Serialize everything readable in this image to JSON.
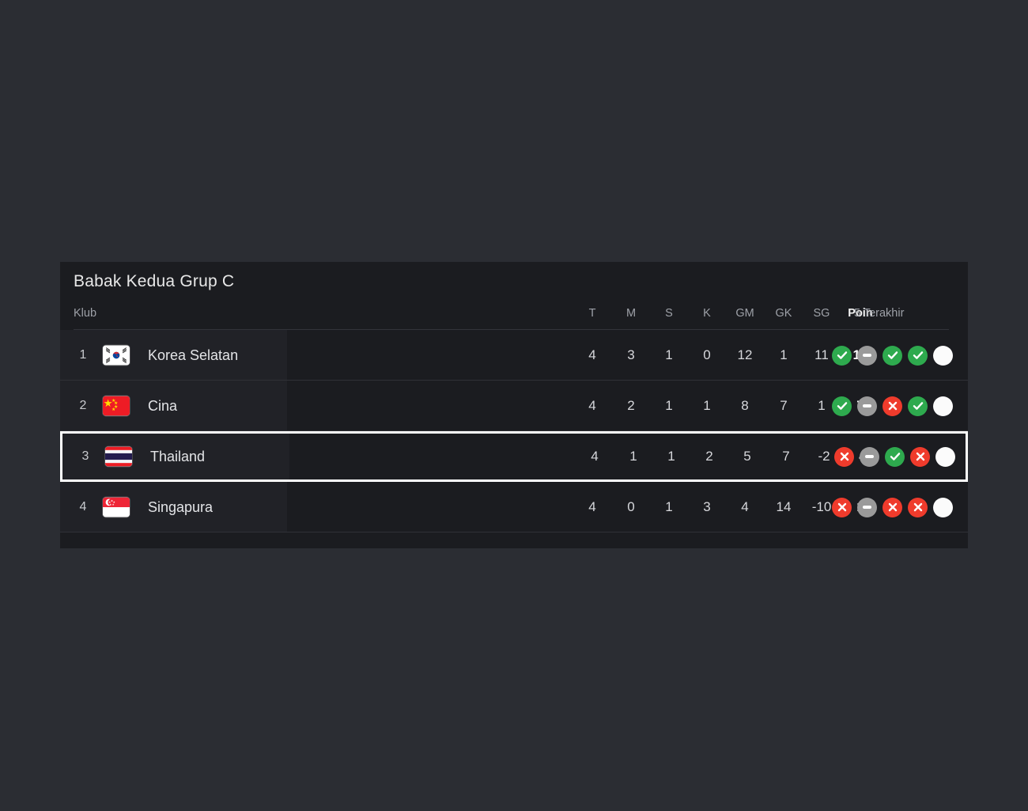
{
  "panel": {
    "title": "Babak Kedua Grup C"
  },
  "table": {
    "headers": {
      "club": "Klub",
      "played": "T",
      "won": "M",
      "drawn": "S",
      "lost": "K",
      "goals_for": "GM",
      "goals_against": "GK",
      "goal_diff": "SG",
      "points": "Poin",
      "form": "5 Terakhir"
    },
    "rows": [
      {
        "rank": "1",
        "club": "Korea Selatan",
        "flag": "flag-south-korea",
        "played": "4",
        "won": "3",
        "drawn": "1",
        "lost": "0",
        "goals_for": "12",
        "goals_against": "1",
        "goal_diff": "11",
        "points": "10",
        "form": [
          "win",
          "draw",
          "win",
          "win",
          "none"
        ],
        "highlighted": false
      },
      {
        "rank": "2",
        "club": "Cina",
        "flag": "flag-china",
        "played": "4",
        "won": "2",
        "drawn": "1",
        "lost": "1",
        "goals_for": "8",
        "goals_against": "7",
        "goal_diff": "1",
        "points": "7",
        "form": [
          "win",
          "draw",
          "loss",
          "win",
          "none"
        ],
        "highlighted": false
      },
      {
        "rank": "3",
        "club": "Thailand",
        "flag": "flag-thailand",
        "played": "4",
        "won": "1",
        "drawn": "1",
        "lost": "2",
        "goals_for": "5",
        "goals_against": "7",
        "goal_diff": "-2",
        "points": "4",
        "form": [
          "loss",
          "draw",
          "win",
          "loss",
          "none"
        ],
        "highlighted": true
      },
      {
        "rank": "4",
        "club": "Singapura",
        "flag": "flag-singapore",
        "played": "4",
        "won": "0",
        "drawn": "1",
        "lost": "3",
        "goals_for": "4",
        "goals_against": "14",
        "goal_diff": "-10",
        "points": "1",
        "form": [
          "loss",
          "draw",
          "loss",
          "loss",
          "none"
        ],
        "highlighted": false
      }
    ]
  },
  "colors": {
    "page_background": "#2b2d33",
    "panel_background": "#1b1c20",
    "row_band": "#212227",
    "win": "#2eaa4e",
    "loss": "#ef3b2c",
    "draw": "#9a9a9a",
    "upcoming": "#fbfbfb",
    "highlight_border": "#ffffff"
  }
}
